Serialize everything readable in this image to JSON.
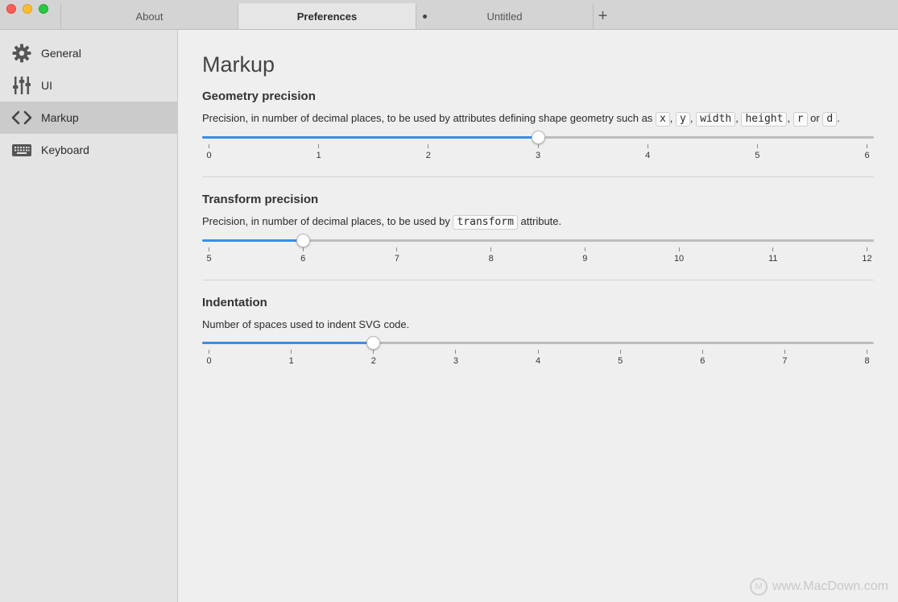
{
  "tabs": [
    {
      "label": "About",
      "active": false,
      "modified": false
    },
    {
      "label": "Preferences",
      "active": true,
      "modified": false
    },
    {
      "label": "Untitled",
      "active": false,
      "modified": true
    }
  ],
  "tab_add_label": "+",
  "sidebar": {
    "items": [
      {
        "label": "General",
        "icon": "gear-icon",
        "active": false
      },
      {
        "label": "UI",
        "icon": "sliders-icon",
        "active": false
      },
      {
        "label": "Markup",
        "icon": "code-brackets-icon",
        "active": true
      },
      {
        "label": "Keyboard",
        "icon": "keyboard-icon",
        "active": false
      }
    ]
  },
  "main": {
    "title": "Markup",
    "geometry": {
      "heading": "Geometry precision",
      "desc_prefix": "Precision, in number of decimal places, to be used by attributes defining shape geometry such as",
      "attrs": [
        "x",
        "y",
        "width",
        "height",
        "r",
        "d"
      ],
      "sep": ",",
      "or": "or",
      "end": ".",
      "min": 0,
      "max": 6,
      "value": 3,
      "ticks": [
        "0",
        "1",
        "2",
        "3",
        "4",
        "5",
        "6"
      ]
    },
    "transform": {
      "heading": "Transform precision",
      "desc_prefix": "Precision, in number of decimal places, to be used by",
      "code": "transform",
      "desc_suffix": "attribute.",
      "min": 5,
      "max": 12,
      "value": 6,
      "ticks": [
        "5",
        "6",
        "7",
        "8",
        "9",
        "10",
        "11",
        "12"
      ]
    },
    "indentation": {
      "heading": "Indentation",
      "desc": "Number of spaces used to indent SVG code.",
      "min": 0,
      "max": 8,
      "value": 2,
      "ticks": [
        "0",
        "1",
        "2",
        "3",
        "4",
        "5",
        "6",
        "7",
        "8"
      ]
    }
  },
  "watermark": "www.MacDown.com",
  "colors": {
    "accent": "#3a8ee6",
    "active_sidebar": "#cbcbcb"
  }
}
